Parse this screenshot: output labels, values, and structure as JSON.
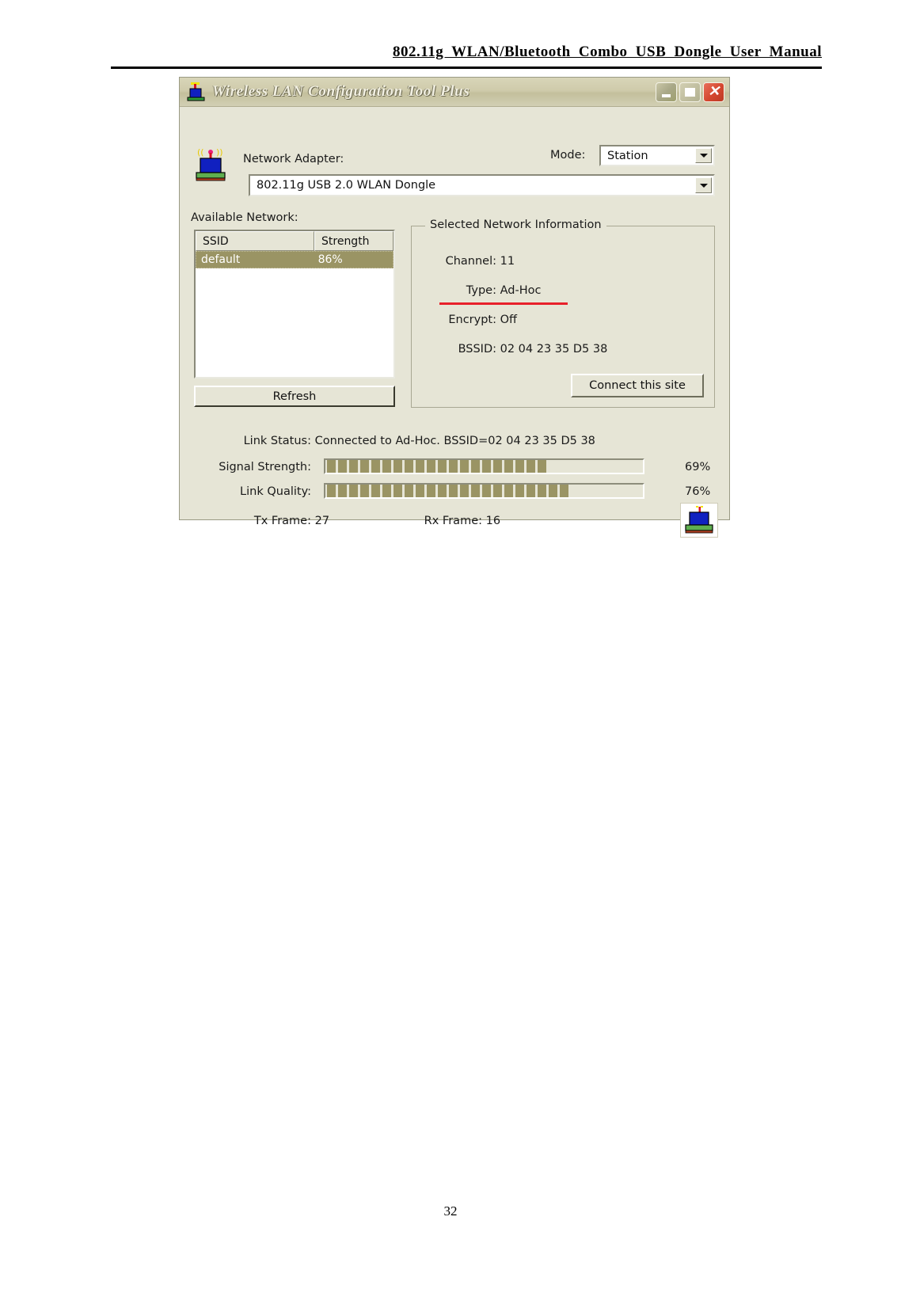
{
  "page": {
    "header_title": "802.11g  WLAN/Bluetooth  Combo  USB  Dongle  User  Manual",
    "page_number": "32"
  },
  "dialog": {
    "title": "Wireless LAN Configuration Tool Plus",
    "title_icon": "wlan-dongle-icon",
    "window_buttons": {
      "minimize": "minimize-icon",
      "maximize": "maximize-icon",
      "close": "close-icon"
    },
    "adapter": {
      "icon": "wlan-adapter-icon",
      "label": "Network Adapter:",
      "value": "802.11g USB 2.0 WLAN Dongle"
    },
    "mode": {
      "label": "Mode:",
      "value": "Station"
    },
    "available_network": {
      "label": "Available Network:",
      "columns": [
        "SSID",
        "Strength"
      ],
      "rows": [
        {
          "ssid": "default",
          "strength": "86%"
        }
      ],
      "refresh_label": "Refresh"
    },
    "selected_network": {
      "title": "Selected Network Information",
      "channel_label": "Channel:",
      "channel_value": "11",
      "type_label": "Type:",
      "type_value": "Ad-Hoc",
      "encrypt_label": "Encrypt:",
      "encrypt_value": "Off",
      "bssid_label": "BSSID:",
      "bssid_value": "02 04 23 35 D5 38",
      "connect_label": "Connect this site",
      "highlight_color": "#e8202a"
    },
    "status": {
      "link_status_label": "Link Status:",
      "link_status_value": "Connected to Ad-Hoc. BSSID=02 04 23 35 D5 38",
      "signal_strength_label": "Signal Strength:",
      "signal_strength_value": "69%",
      "signal_strength_percent": 69,
      "link_quality_label": "Link Quality:",
      "link_quality_value": "76%",
      "link_quality_percent": 76,
      "tx_frame_label": "Tx Frame:",
      "tx_frame_value": "27",
      "rx_frame_label": "Rx Frame:",
      "rx_frame_value": "16",
      "tray_icon": "wlan-status-tray-icon"
    }
  }
}
